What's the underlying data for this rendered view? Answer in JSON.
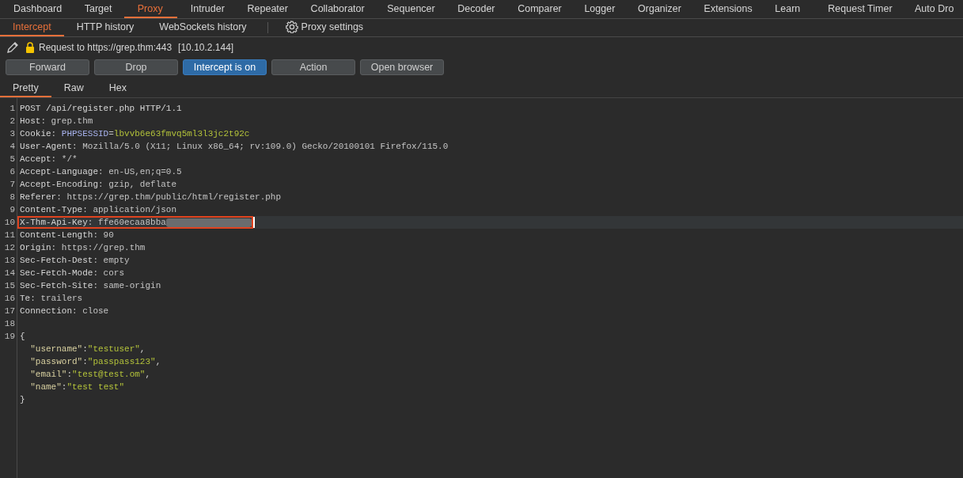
{
  "main_tabs": [
    {
      "label": "Dashboard",
      "selected": false
    },
    {
      "label": "Target",
      "selected": false
    },
    {
      "label": "Proxy",
      "selected": true
    },
    {
      "label": "Intruder",
      "selected": false
    },
    {
      "label": "Repeater",
      "selected": false
    },
    {
      "label": "Collaborator",
      "selected": false
    },
    {
      "label": "Sequencer",
      "selected": false
    },
    {
      "label": "Decoder",
      "selected": false
    },
    {
      "label": "Comparer",
      "selected": false
    },
    {
      "label": "Logger",
      "selected": false
    },
    {
      "label": "Organizer",
      "selected": false
    },
    {
      "label": "Extensions",
      "selected": false
    },
    {
      "label": "Learn",
      "selected": false
    },
    {
      "label": "Request Timer",
      "selected": false
    },
    {
      "label": "Auto Dro",
      "selected": false
    }
  ],
  "sub_tabs": [
    {
      "label": "Intercept",
      "selected": true,
      "kind": "tab"
    },
    {
      "label": "HTTP history",
      "selected": false,
      "kind": "tab"
    },
    {
      "label": "WebSockets history",
      "selected": false,
      "kind": "tab"
    },
    {
      "label": "Proxy settings",
      "selected": false,
      "kind": "settings"
    }
  ],
  "request_info": {
    "text": "Request to https://grep.thm:443",
    "ip": "[10.10.2.144]"
  },
  "buttons": [
    {
      "label": "Forward",
      "on": false
    },
    {
      "label": "Drop",
      "on": false
    },
    {
      "label": "Intercept is on",
      "on": true
    },
    {
      "label": "Action",
      "on": false
    },
    {
      "label": "Open browser",
      "on": false
    }
  ],
  "view_tabs": [
    {
      "label": "Pretty",
      "selected": true
    },
    {
      "label": "Raw",
      "selected": false
    },
    {
      "label": "Hex",
      "selected": false
    }
  ],
  "lines": [
    {
      "number": "1",
      "highlighted": false,
      "segments": [
        {
          "text": "POST /api/register.php HTTP/1.1",
          "kind": "plain"
        }
      ]
    },
    {
      "number": "2",
      "highlighted": false,
      "segments": [
        {
          "text": "Host",
          "kind": "key"
        },
        {
          "text": ": grep.thm",
          "kind": "value"
        }
      ]
    },
    {
      "number": "3",
      "highlighted": false,
      "segments": [
        {
          "text": "Cookie",
          "kind": "key"
        },
        {
          "text": ": ",
          "kind": "value"
        },
        {
          "text": "PHPSESSID",
          "kind": "cookie-name"
        },
        {
          "text": "=",
          "kind": "value"
        },
        {
          "text": "lbvvb6e63fmvq5ml3l3jc2t92c",
          "kind": "cookie-value"
        }
      ]
    },
    {
      "number": "4",
      "highlighted": false,
      "segments": [
        {
          "text": "User-Agent",
          "kind": "key"
        },
        {
          "text": ": Mozilla/5.0 (X11; Linux x86_64; rv:109.0) Gecko/20100101 Firefox/115.0",
          "kind": "value"
        }
      ]
    },
    {
      "number": "5",
      "highlighted": false,
      "segments": [
        {
          "text": "Accept",
          "kind": "key"
        },
        {
          "text": ": */*",
          "kind": "value"
        }
      ]
    },
    {
      "number": "6",
      "highlighted": false,
      "segments": [
        {
          "text": "Accept-Language",
          "kind": "key"
        },
        {
          "text": ": en-US,en;q=0.5",
          "kind": "value"
        }
      ]
    },
    {
      "number": "7",
      "highlighted": false,
      "segments": [
        {
          "text": "Accept-Encoding",
          "kind": "key"
        },
        {
          "text": ": gzip, deflate",
          "kind": "value"
        }
      ]
    },
    {
      "number": "8",
      "highlighted": false,
      "segments": [
        {
          "text": "Referer",
          "kind": "key"
        },
        {
          "text": ": https://grep.thm/public/html/register.php",
          "kind": "value"
        }
      ]
    },
    {
      "number": "9",
      "highlighted": false,
      "segments": [
        {
          "text": "Content-Type",
          "kind": "key"
        },
        {
          "text": ": application/json",
          "kind": "value"
        }
      ]
    },
    {
      "number": "10",
      "highlighted": true,
      "redacted": true,
      "segments": [
        {
          "text": "X-Thm-Api-Key",
          "kind": "key"
        },
        {
          "text": ": ffe60ecaa8bba",
          "kind": "value"
        }
      ]
    },
    {
      "number": "11",
      "highlighted": false,
      "segments": [
        {
          "text": "Content-Length",
          "kind": "key"
        },
        {
          "text": ": 90",
          "kind": "value"
        }
      ]
    },
    {
      "number": "12",
      "highlighted": false,
      "segments": [
        {
          "text": "Origin",
          "kind": "key"
        },
        {
          "text": ": https://grep.thm",
          "kind": "value"
        }
      ]
    },
    {
      "number": "13",
      "highlighted": false,
      "segments": [
        {
          "text": "Sec-Fetch-Dest",
          "kind": "key"
        },
        {
          "text": ": empty",
          "kind": "value"
        }
      ]
    },
    {
      "number": "14",
      "highlighted": false,
      "segments": [
        {
          "text": "Sec-Fetch-Mode",
          "kind": "key"
        },
        {
          "text": ": cors",
          "kind": "value"
        }
      ]
    },
    {
      "number": "15",
      "highlighted": false,
      "segments": [
        {
          "text": "Sec-Fetch-Site",
          "kind": "key"
        },
        {
          "text": ": same-origin",
          "kind": "value"
        }
      ]
    },
    {
      "number": "16",
      "highlighted": false,
      "segments": [
        {
          "text": "Te",
          "kind": "key"
        },
        {
          "text": ": trailers",
          "kind": "value"
        }
      ]
    },
    {
      "number": "17",
      "highlighted": false,
      "segments": [
        {
          "text": "Connection",
          "kind": "key"
        },
        {
          "text": ": close",
          "kind": "value"
        }
      ]
    },
    {
      "number": "18",
      "highlighted": false
    },
    {
      "number": "19",
      "highlighted": false,
      "segments": [
        {
          "text": "{",
          "kind": "plain"
        }
      ]
    },
    {
      "highlighted": false,
      "segments": [
        {
          "text": "  \"username\"",
          "kind": "json-key"
        },
        {
          "text": ":",
          "kind": "plain"
        },
        {
          "text": "\"testuser\"",
          "kind": "json-value"
        },
        {
          "text": ",",
          "kind": "plain"
        }
      ]
    },
    {
      "highlighted": false,
      "segments": [
        {
          "text": "  \"password\"",
          "kind": "json-key"
        },
        {
          "text": ":",
          "kind": "plain"
        },
        {
          "text": "\"passpass123\"",
          "kind": "json-value"
        },
        {
          "text": ",",
          "kind": "plain"
        }
      ]
    },
    {
      "highlighted": false,
      "segments": [
        {
          "text": "  \"email\"",
          "kind": "json-key"
        },
        {
          "text": ":",
          "kind": "plain"
        },
        {
          "text": "\"test@test.om\"",
          "kind": "json-value"
        },
        {
          "text": ",",
          "kind": "plain"
        }
      ]
    },
    {
      "highlighted": false,
      "segments": [
        {
          "text": "  \"name\"",
          "kind": "json-key"
        },
        {
          "text": ":",
          "kind": "plain"
        },
        {
          "text": "\"test test\"",
          "kind": "json-value"
        }
      ]
    },
    {
      "highlighted": false,
      "segments": [
        {
          "text": "}",
          "kind": "plain"
        }
      ]
    }
  ]
}
